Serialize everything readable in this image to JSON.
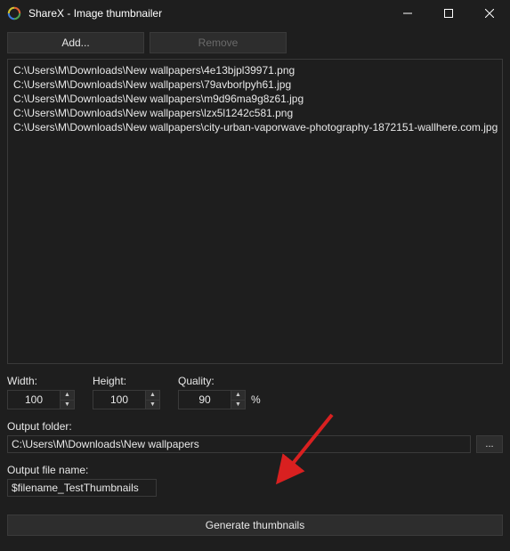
{
  "window": {
    "title": "ShareX - Image thumbnailer"
  },
  "toolbar": {
    "add_label": "Add...",
    "remove_label": "Remove"
  },
  "files": [
    "C:\\Users\\M\\Downloads\\New wallpapers\\4e13bjpl39971.png",
    "C:\\Users\\M\\Downloads\\New wallpapers\\79avborlpyh61.jpg",
    "C:\\Users\\M\\Downloads\\New wallpapers\\m9d96ma9g8z61.jpg",
    "C:\\Users\\M\\Downloads\\New wallpapers\\lzx5l1242c581.png",
    "C:\\Users\\M\\Downloads\\New wallpapers\\city-urban-vaporwave-photography-1872151-wallhere.com.jpg"
  ],
  "dims": {
    "width_label": "Width:",
    "width_value": "100",
    "height_label": "Height:",
    "height_value": "100",
    "quality_label": "Quality:",
    "quality_value": "90",
    "pct": "%"
  },
  "output_folder": {
    "label": "Output folder:",
    "value": "C:\\Users\\M\\Downloads\\New wallpapers",
    "browse": "..."
  },
  "output_name": {
    "label": "Output file name:",
    "value": "$filename_TestThumbnails"
  },
  "generate_label": "Generate thumbnails"
}
